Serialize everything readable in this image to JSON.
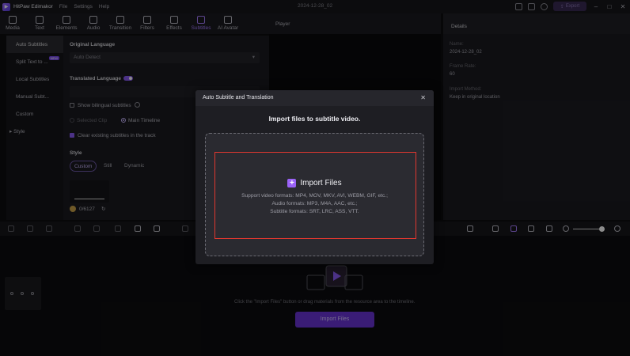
{
  "titlebar": {
    "app_name": "HitPaw Edimakor",
    "menu": [
      "File",
      "Settings",
      "Help"
    ],
    "project_title": "2024-12-28_02",
    "export_label": "Export"
  },
  "tabs": [
    {
      "label": "Media",
      "icon": "media-icon"
    },
    {
      "label": "Text",
      "icon": "text-icon"
    },
    {
      "label": "Elements",
      "icon": "elements-icon"
    },
    {
      "label": "Audio",
      "icon": "audio-icon"
    },
    {
      "label": "Transition",
      "icon": "transition-icon"
    },
    {
      "label": "Filters",
      "icon": "filters-icon"
    },
    {
      "label": "Effects",
      "icon": "effects-icon"
    },
    {
      "label": "Subtitles",
      "icon": "subtitles-icon",
      "active": true
    },
    {
      "label": "AI Avatar",
      "icon": "avatar-icon"
    }
  ],
  "sidebar": {
    "items": [
      {
        "label": "Auto Subtitles",
        "active": true
      },
      {
        "label": "Split Text to ...",
        "badge": "NEW"
      },
      {
        "label": "Local Subtitles"
      },
      {
        "label": "Manual Subt..."
      },
      {
        "label": "Custom"
      },
      {
        "label": "Style",
        "group": true
      }
    ]
  },
  "subtitle_panel": {
    "original_language_label": "Original Language",
    "original_language_value": "Auto Detect",
    "translated_language_label": "Translated Language",
    "translated_toggle_on": true,
    "show_bilingual_label": "Show bilingual subtitles",
    "selected_clip_label": "Selected Clip",
    "main_timeline_label": "Main Timeline",
    "clear_existing_label": "Clear existing subtitles in the track",
    "style_label": "Style",
    "style_options": [
      "Custom",
      "Still",
      "Dynamic"
    ],
    "credits": "0/6127"
  },
  "player": {
    "title": "Player"
  },
  "details": {
    "title": "Details",
    "fields": [
      {
        "key": "Name:",
        "value": "2024-12-28_02"
      },
      {
        "key": "Frame Rate:",
        "value": "60"
      },
      {
        "key": "Import Method:",
        "value": "Keep in original location"
      }
    ]
  },
  "timeline": {
    "hint": "Click the \"Import Files\" button or drag materials from the resource area to the timeline.",
    "import_button": "Import Files"
  },
  "modal": {
    "title": "Auto Subtitle and Translation",
    "subtitle": "Import files to subtitle video.",
    "import_label": "Import Files",
    "formats": [
      "Support video formats: MP4, MOV, MKV, AVI, WEBM, GIF, etc.;",
      "Audio formats: MP3, M4A, AAC, etc.;",
      "Subtitle formats: SRT, LRC, ASS, VTT."
    ]
  },
  "colors": {
    "accent": "#8a5cf6",
    "highlight_border": "#e0372f",
    "modal_bg": "#1e1e23"
  }
}
